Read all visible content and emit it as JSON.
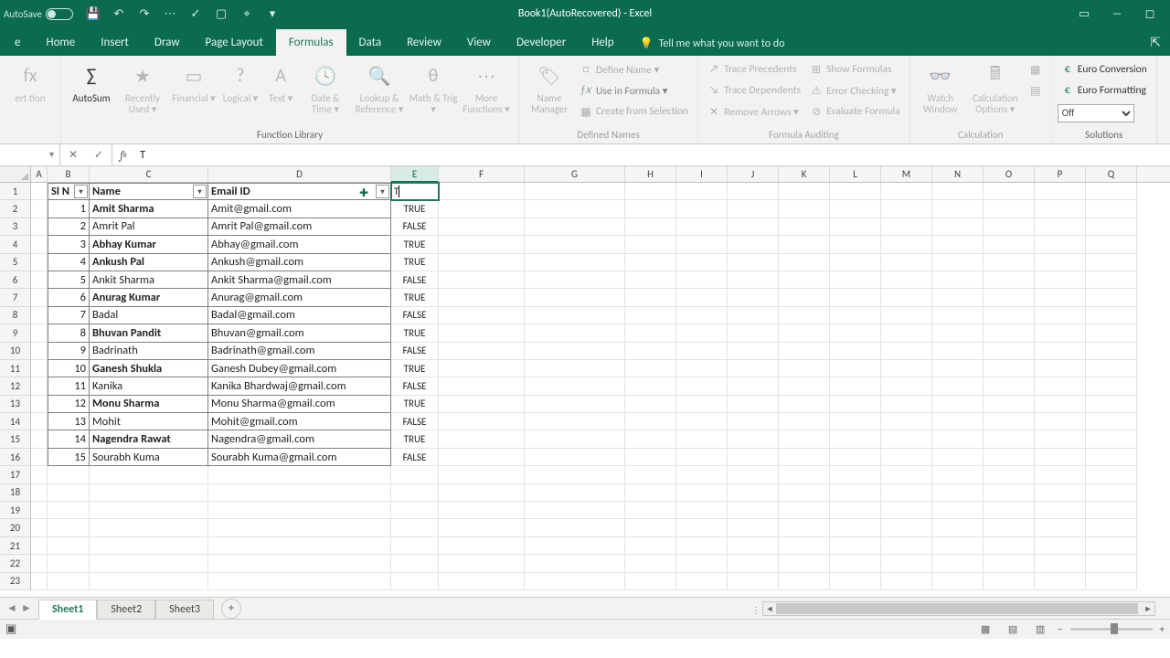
{
  "app": {
    "title": "Book1(AutoRecovered) - Excel",
    "autosave": "AutoSave"
  },
  "tabs": {
    "file": "e",
    "home": "Home",
    "insert": "Insert",
    "draw": "Draw",
    "pagelayout": "Page Layout",
    "formulas": "Formulas",
    "data": "Data",
    "review": "Review",
    "view": "View",
    "developer": "Developer",
    "help": "Help",
    "tellme": "Tell me what you want to do"
  },
  "ribbon": {
    "fLib": {
      "autosum": "AutoSum",
      "recent": "Recently Used ▾",
      "financial": "Financial ▾",
      "logical": "Logical ▾",
      "text": "Text ▾",
      "datetime": "Date & Time ▾",
      "lookup": "Lookup & Reference ▾",
      "math": "Math & Trig ▾",
      "more": "More Functions ▾",
      "label": "Function Library",
      "insertfn": "ert tion"
    },
    "names": {
      "manager": "Name Manager",
      "define": "Define Name ▾",
      "usein": "Use in Formula ▾",
      "createsel": "Create from Selection",
      "label": "Defined Names"
    },
    "audit": {
      "tracep": "Trace Precedents",
      "traced": "Trace Dependents",
      "removea": "Remove Arrows ▾",
      "showf": "Show Formulas",
      "errchk": "Error Checking ▾",
      "evalf": "Evaluate Formula",
      "label": "Formula Auditing"
    },
    "calc": {
      "watch": "Watch Window",
      "options": "Calculation Options ▾",
      "label": "Calculation"
    },
    "sol": {
      "conv": "Euro Conversion",
      "fmt": "Euro Formatting",
      "off": "Off",
      "label": "Solutions"
    }
  },
  "fx": {
    "name": "",
    "value": "T"
  },
  "columns": [
    "A",
    "B",
    "C",
    "D",
    "E",
    "F",
    "G",
    "H",
    "I",
    "J",
    "K",
    "L",
    "M",
    "N",
    "O",
    "P",
    "Q"
  ],
  "headers": {
    "sln": "Sl N",
    "name": "Name",
    "email": "Email ID"
  },
  "editing": {
    "cell": "T"
  },
  "rows": [
    {
      "n": "1",
      "name": "Amit Sharma",
      "email": "Amit@gmail.com",
      "e": "TRUE",
      "bold": true
    },
    {
      "n": "2",
      "name": "Amrit Pal",
      "email": "Amrit Pal@gmail.com",
      "e": "FALSE",
      "bold": false
    },
    {
      "n": "3",
      "name": "Abhay Kumar",
      "email": "Abhay@gmail.com",
      "e": "TRUE",
      "bold": true
    },
    {
      "n": "4",
      "name": "Ankush Pal",
      "email": "Ankush@gmail.com",
      "e": "TRUE",
      "bold": true
    },
    {
      "n": "5",
      "name": "Ankit Sharma",
      "email": "Ankit Sharma@gmail.com",
      "e": "FALSE",
      "bold": false
    },
    {
      "n": "6",
      "name": "Anurag Kumar",
      "email": "Anurag@gmail.com",
      "e": "TRUE",
      "bold": true
    },
    {
      "n": "7",
      "name": "Badal",
      "email": "Badal@gmail.com",
      "e": "FALSE",
      "bold": false
    },
    {
      "n": "8",
      "name": "Bhuvan Pandit",
      "email": "Bhuvan@gmail.com",
      "e": "TRUE",
      "bold": true
    },
    {
      "n": "9",
      "name": "Badrinath",
      "email": "Badrinath@gmail.com",
      "e": "FALSE",
      "bold": false
    },
    {
      "n": "10",
      "name": "Ganesh Shukla",
      "email": "Ganesh Dubey@gmail.com",
      "e": "TRUE",
      "bold": true
    },
    {
      "n": "11",
      "name": "Kanika",
      "email": "Kanika Bhardwaj@gmail.com",
      "e": "FALSE",
      "bold": false
    },
    {
      "n": "12",
      "name": "Monu Sharma",
      "email": "Monu Sharma@gmail.com",
      "e": "TRUE",
      "bold": true
    },
    {
      "n": "13",
      "name": "Mohit",
      "email": "Mohit@gmail.com",
      "e": "FALSE",
      "bold": false
    },
    {
      "n": "14",
      "name": "Nagendra Rawat",
      "email": "Nagendra@gmail.com",
      "e": "TRUE",
      "bold": true
    },
    {
      "n": "15",
      "name": "Sourabh Kuma",
      "email": "Sourabh Kuma@gmail.com",
      "e": "FALSE",
      "bold": false
    }
  ],
  "sheets": {
    "s1": "Sheet1",
    "s2": "Sheet2",
    "s3": "Sheet3"
  },
  "status": {
    "mode": "",
    "zoom": ""
  }
}
